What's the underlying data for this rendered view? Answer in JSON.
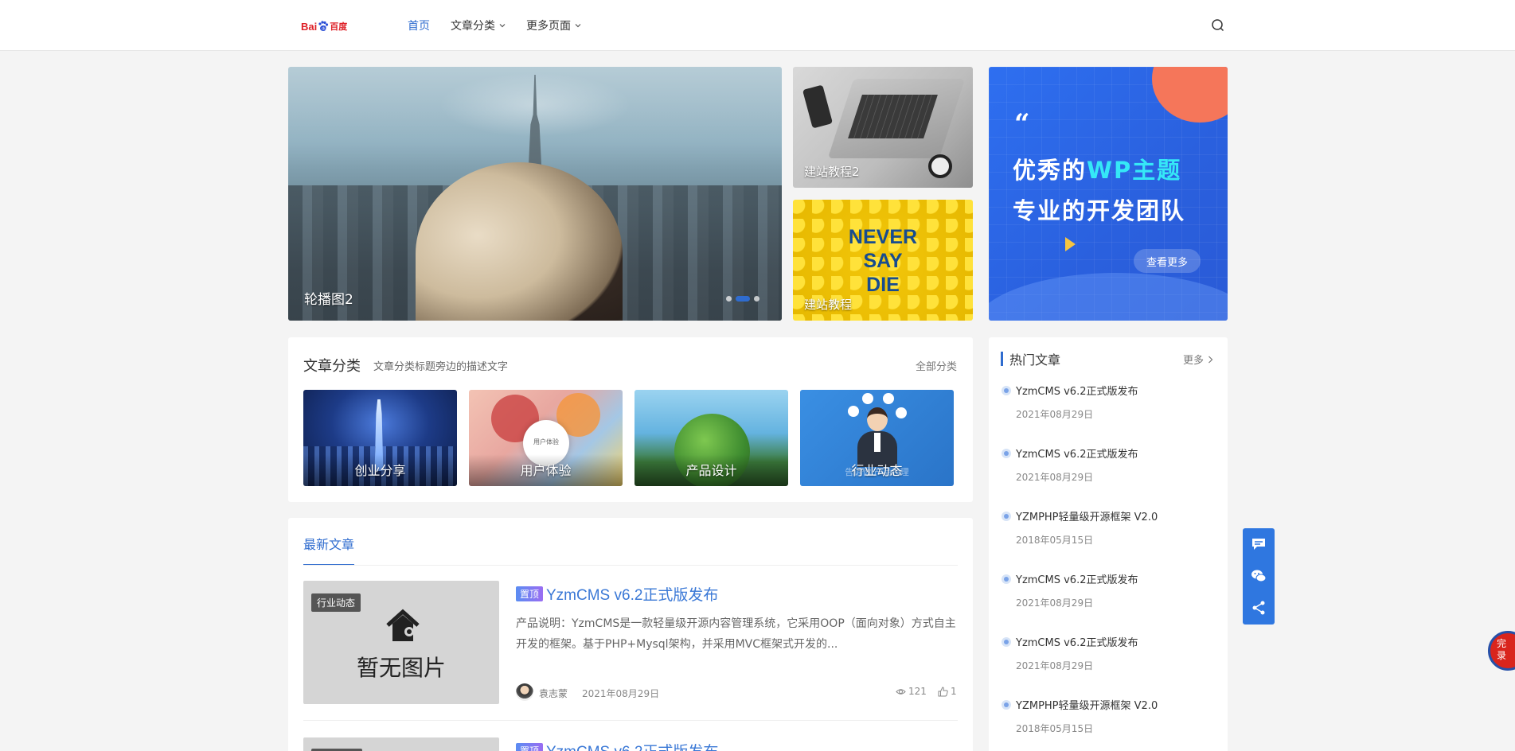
{
  "header": {
    "logo": {
      "part1": "Bai",
      "part2": "百度"
    },
    "nav": [
      {
        "label": "首页",
        "active": true,
        "has_dropdown": false
      },
      {
        "label": "文章分类",
        "active": false,
        "has_dropdown": true
      },
      {
        "label": "更多页面",
        "active": false,
        "has_dropdown": true
      }
    ]
  },
  "slider": {
    "caption": "轮播图2",
    "slides_count": 3,
    "active_slide": 2
  },
  "feature_cards": [
    {
      "caption": "建站教程2",
      "icon": "laptop-photo"
    },
    {
      "caption": "建站教程",
      "icon": "never-say-die-photo",
      "image_text": [
        "NEVER",
        "SAY",
        "DIE"
      ]
    }
  ],
  "banner": {
    "quote_mark": "“",
    "line1_prefix": "优秀的",
    "line1_highlight": "WP主题",
    "line2": "专业的开发团队",
    "button": "查看更多"
  },
  "categories": {
    "title": "文章分类",
    "description": "文章分类标题旁边的描述文字",
    "all_link": "全部分类",
    "items": [
      {
        "label": "创业分享"
      },
      {
        "label": "用户体验",
        "image_text": "用户体验"
      },
      {
        "label": "产品设计"
      },
      {
        "label": "行业动态",
        "image_text": "告诉你 产品经理"
      }
    ]
  },
  "latest": {
    "tab": "最新文章",
    "posts": [
      {
        "category": "行业动态",
        "thumb_text": "暂无图片",
        "badge": "置顶",
        "title": "YzmCMS v6.2正式版发布",
        "excerpt": "产品说明：YzmCMS是一款轻量级开源内容管理系统，它采用OOP（面向对象）方式自主开发的框架。基于PHP+Mysql架构，并采用MVC框架式开发的...",
        "author": "袁志蒙",
        "date": "2021年08月29日",
        "views": "121",
        "likes": "1"
      },
      {
        "badge": "置顶",
        "title": "YzmCMS v6.2正式版发布"
      }
    ]
  },
  "hot": {
    "title": "热门文章",
    "more": "更多",
    "items": [
      {
        "title": "YzmCMS v6.2正式版发布",
        "date": "2021年08月29日"
      },
      {
        "title": "YzmCMS v6.2正式版发布",
        "date": "2021年08月29日"
      },
      {
        "title": "YZMPHP轻量级开源框架 V2.0",
        "date": "2018年05月15日"
      },
      {
        "title": "YzmCMS v6.2正式版发布",
        "date": "2021年08月29日"
      },
      {
        "title": "YzmCMS v6.2正式版发布",
        "date": "2021年08月29日"
      },
      {
        "title": "YZMPHP轻量级开源框架 V2.0",
        "date": "2018年05月15日"
      }
    ]
  },
  "float_bar": {
    "buttons": [
      "comment-icon",
      "wechat-icon",
      "share-icon"
    ]
  },
  "corner_badge": {
    "line1": "完",
    "line2": "录"
  },
  "colors": {
    "accent": "#2f6ccf",
    "banner": "#2a60de",
    "banner_highlight": "#35e8f7",
    "float_bar": "#2f77e0"
  }
}
